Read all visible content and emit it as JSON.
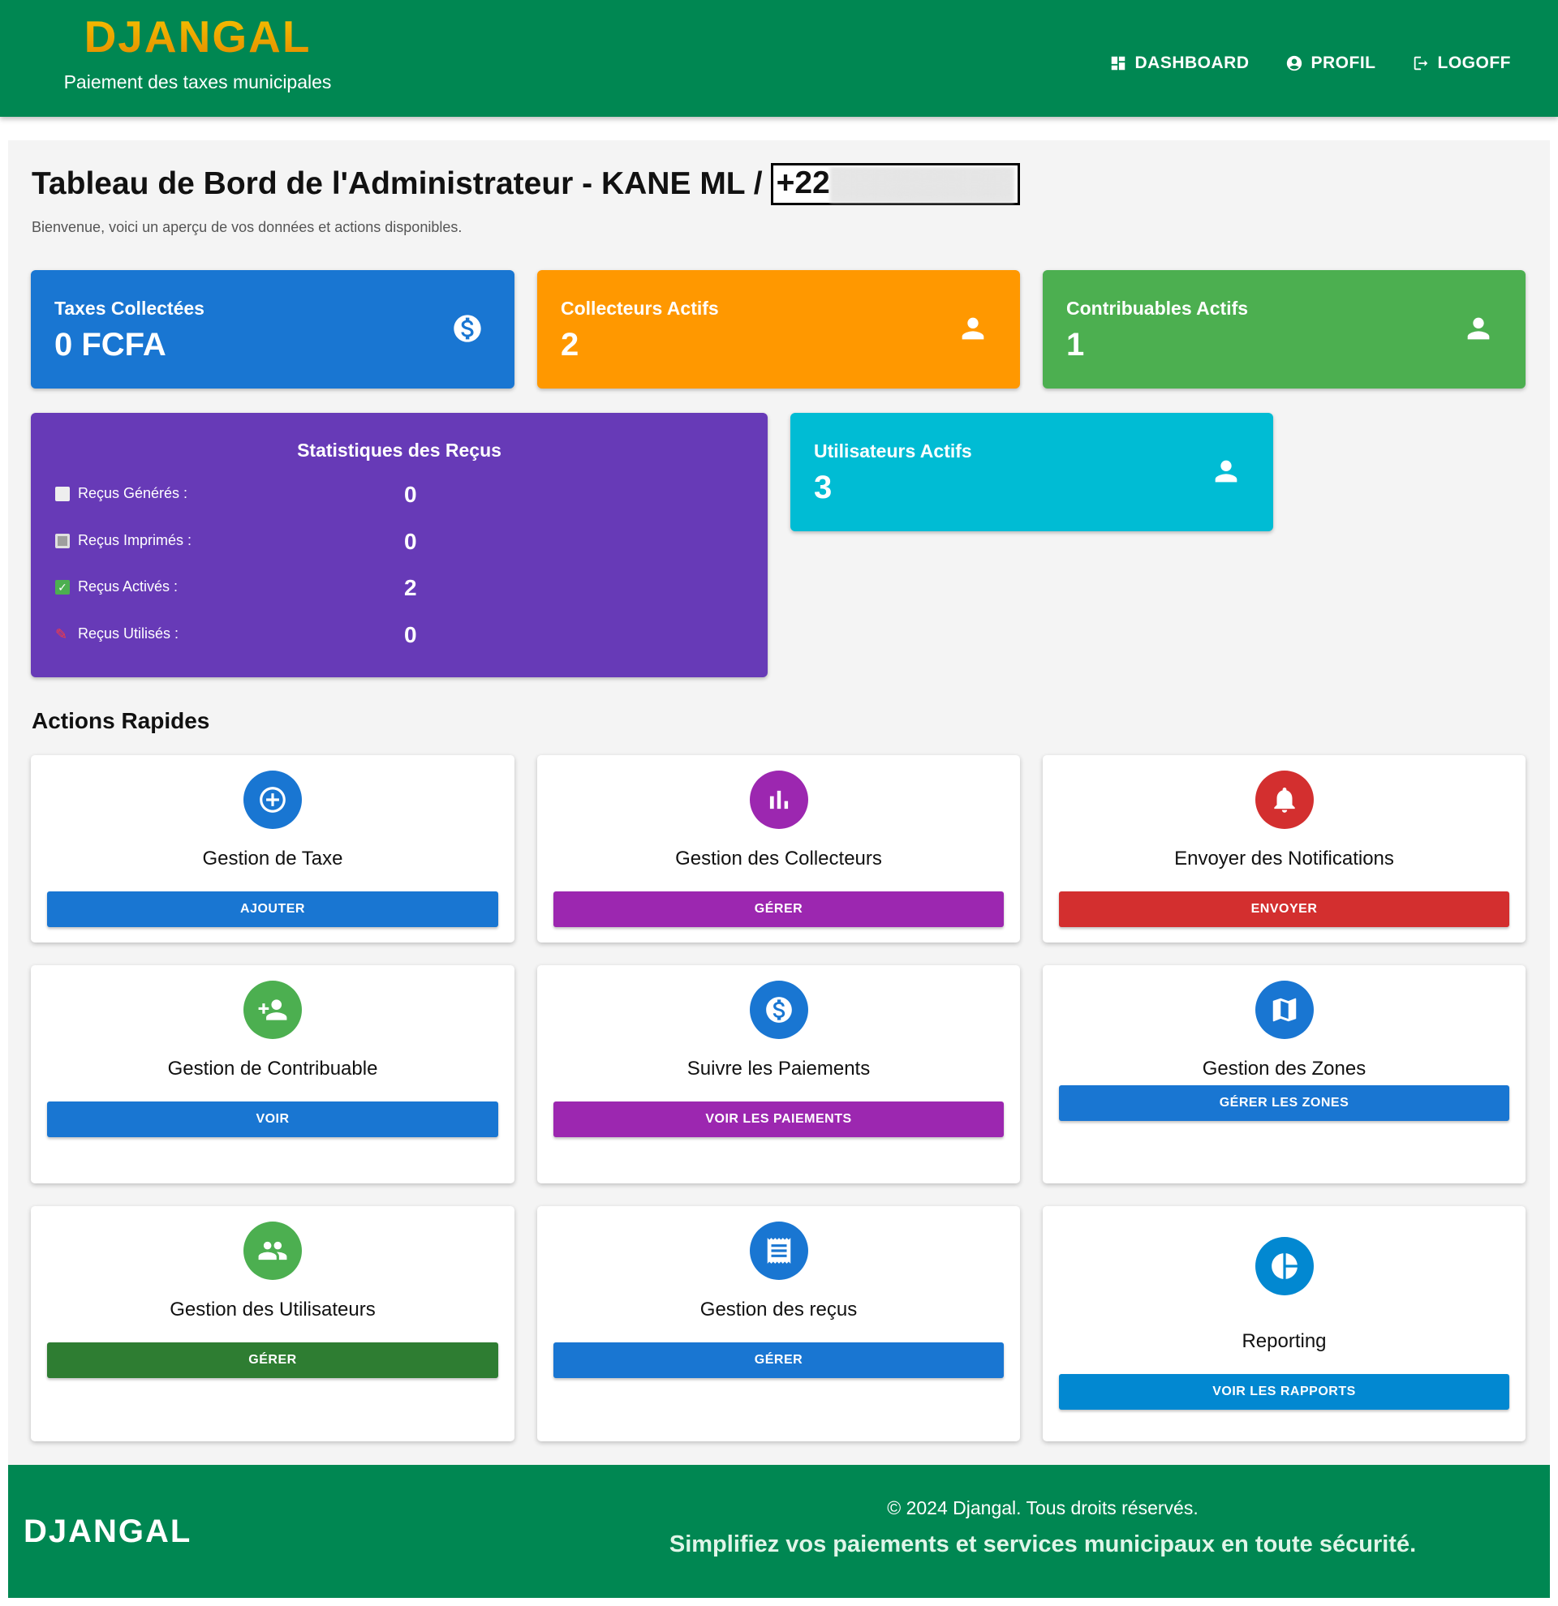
{
  "header": {
    "brand": "DJANGAL",
    "tagline": "Paiement des taxes municipales",
    "nav": [
      {
        "label": "DASHBOARD",
        "icon": "dashboard-icon"
      },
      {
        "label": "PROFIL",
        "icon": "account-circle-icon"
      },
      {
        "label": "LOGOFF",
        "icon": "logout-icon"
      }
    ]
  },
  "page": {
    "title": "Tableau de Bord de l'Administrateur - KANE ML /",
    "phone": "+22",
    "subtitle": "Bienvenue, voici un aperçu de vos données et actions disponibles."
  },
  "stats": [
    {
      "label": "Taxes Collectées",
      "value": "0 FCFA",
      "icon": "dollar-icon",
      "color": "#1976d2"
    },
    {
      "label": "Collecteurs Actifs",
      "value": "2",
      "icon": "person-icon",
      "color": "#ff9800"
    },
    {
      "label": "Contribuables Actifs",
      "value": "1",
      "icon": "person-icon",
      "color": "#4caf50"
    },
    {
      "label": "Utilisateurs Actifs",
      "value": "3",
      "icon": "person-icon",
      "color": "#00bcd4"
    }
  ],
  "receipts": {
    "title": "Statistiques des Reçus",
    "rows": [
      {
        "label": "Reçus Générés :",
        "value": "0",
        "icon": "page-icon"
      },
      {
        "label": "Reçus Imprimés :",
        "value": "0",
        "icon": "printer-icon"
      },
      {
        "label": "Reçus Activés :",
        "value": "2",
        "icon": "check-box-icon"
      },
      {
        "label": "Reçus Utilisés :",
        "value": "0",
        "icon": "pushpin-icon"
      }
    ]
  },
  "actions_title": "Actions Rapides",
  "actions": [
    {
      "name": "Gestion de Taxe",
      "button": "AJOUTER",
      "icon": "add-circle-icon",
      "circle": "#1976d2",
      "btn": "#1976d2"
    },
    {
      "name": "Gestion des Collecteurs",
      "button": "GÉRER",
      "icon": "bar-chart-icon",
      "circle": "#9c27b0",
      "btn": "#9c27b0"
    },
    {
      "name": "Envoyer des Notifications",
      "button": "ENVOYER",
      "icon": "bell-icon",
      "circle": "#d32f2f",
      "btn": "#d32f2f"
    },
    {
      "name": "Gestion de Contribuable",
      "button": "VOIR",
      "icon": "person-add-icon",
      "circle": "#4caf50",
      "btn": "#1976d2"
    },
    {
      "name": "Suivre les Paiements",
      "button": "VOIR LES PAIEMENTS",
      "icon": "dollar-icon",
      "circle": "#1976d2",
      "btn": "#9c27b0"
    },
    {
      "name": "Gestion des Zones",
      "button": "GÉRER LES ZONES",
      "icon": "map-icon",
      "circle": "#1976d2",
      "btn": "#1976d2"
    },
    {
      "name": "Gestion des Utilisateurs",
      "button": "GÉRER",
      "icon": "group-icon",
      "circle": "#4caf50",
      "btn": "#2e7d32"
    },
    {
      "name": "Gestion des reçus",
      "button": "GÉRER",
      "icon": "receipt-icon",
      "circle": "#1976d2",
      "btn": "#1976d2"
    },
    {
      "name": "Reporting",
      "button": "VOIR LES RAPPORTS",
      "icon": "pie-chart-icon",
      "circle": "#0288d1",
      "btn": "#0288d1"
    }
  ],
  "footer": {
    "brand": "DJANGAL",
    "copyright": "© 2024 Djangal. Tous droits réservés.",
    "slogan": "Simplifiez vos paiements et services municipaux en toute sécurité."
  }
}
